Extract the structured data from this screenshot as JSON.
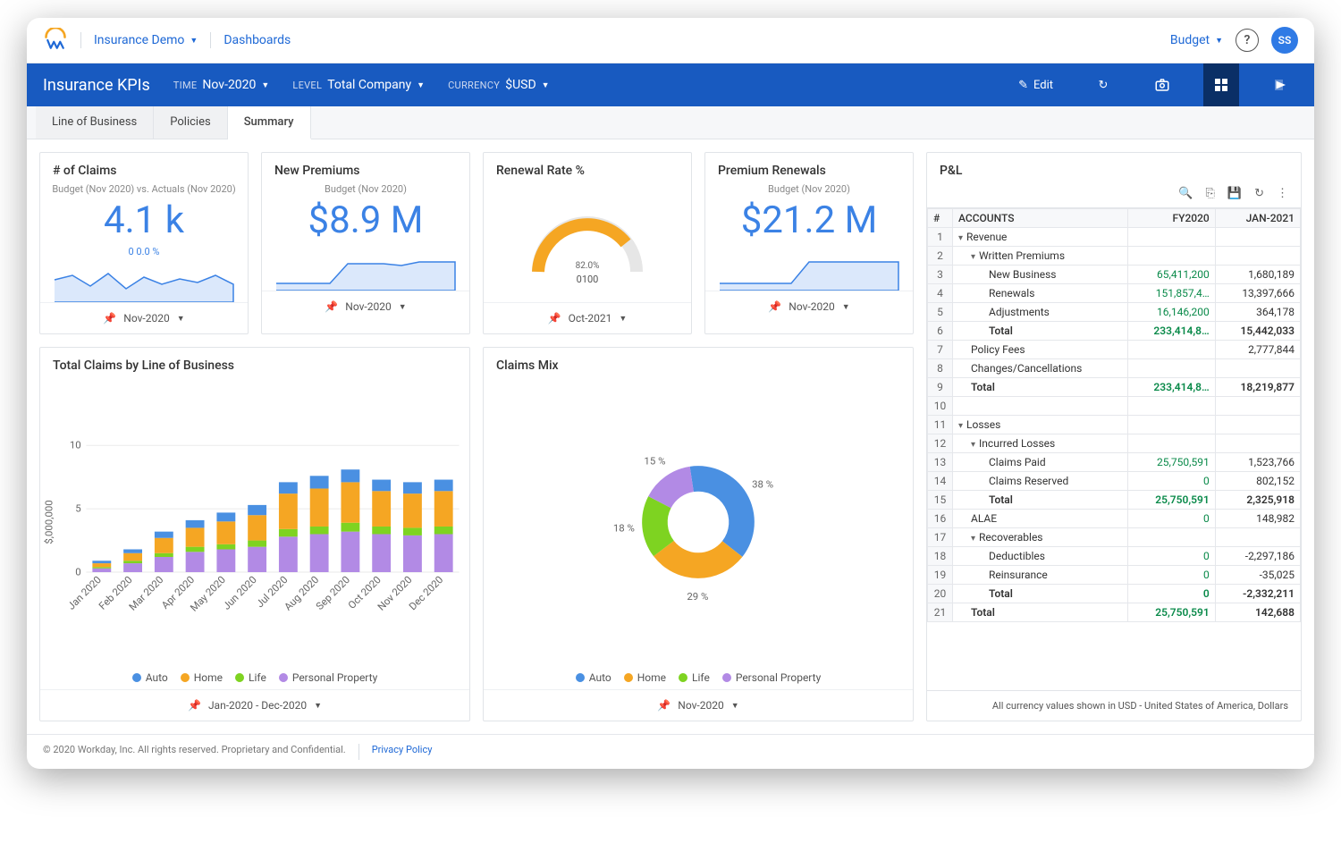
{
  "header": {
    "project": "Insurance Demo",
    "nav2": "Dashboards",
    "right_menu": "Budget",
    "avatar": "SS"
  },
  "bluebar": {
    "title": "Insurance KPIs",
    "time_lbl": "TIME",
    "time_val": "Nov-2020",
    "level_lbl": "LEVEL",
    "level_val": "Total Company",
    "currency_lbl": "CURRENCY",
    "currency_val": "$USD",
    "edit": "Edit"
  },
  "tabs": [
    "Line of Business",
    "Policies",
    "Summary"
  ],
  "active_tab": 2,
  "cards": {
    "claims": {
      "title": "# of Claims",
      "sub": "Budget (Nov 2020) vs. Actuals (Nov 2020)",
      "metric": "4.1 k",
      "delta": "0   0.0 %",
      "foot": "Nov-2020"
    },
    "premiums": {
      "title": "New Premiums",
      "sub": "Budget (Nov 2020)",
      "metric": "$8.9 M",
      "foot": "Nov-2020"
    },
    "renewal": {
      "title": "Renewal Rate %",
      "gauge_pct": "82.0%",
      "g0": "0",
      "g100": "100",
      "foot": "Oct-2021"
    },
    "prenew": {
      "title": "Premium Renewals",
      "sub": "Budget (Nov 2020)",
      "metric": "$21.2 M",
      "foot": "Nov-2020"
    }
  },
  "totalClaims": {
    "title": "Total Claims by Line of Business",
    "ylabel": "$,000,000",
    "foot": "Jan-2020 - Dec-2020"
  },
  "claimsMix": {
    "title": "Claims Mix",
    "foot": "Nov-2020"
  },
  "legend": {
    "auto": "Auto",
    "home": "Home",
    "life": "Life",
    "pp": "Personal Property"
  },
  "colors": {
    "auto": "#4a90e2",
    "home": "#f5a623",
    "life": "#7ed321",
    "pp": "#b28ae5"
  },
  "pnl": {
    "title": "P&L",
    "headers": {
      "acct": "ACCOUNTS",
      "c1": "FY2020",
      "c2": "JAN-2021"
    },
    "rows": [
      {
        "n": 1,
        "lvl": 0,
        "caret": "▾",
        "label": "Revenue",
        "c1": "",
        "c2": ""
      },
      {
        "n": 2,
        "lvl": 1,
        "caret": "▾",
        "label": "Written Premiums",
        "c1": "",
        "c2": ""
      },
      {
        "n": 3,
        "lvl": 2,
        "label": "New Business",
        "c1": "65,411,200",
        "c2": "1,680,189",
        "g1": true
      },
      {
        "n": 4,
        "lvl": 2,
        "label": "Renewals",
        "c1": "151,857,4…",
        "c2": "13,397,666",
        "g1": true
      },
      {
        "n": 5,
        "lvl": 2,
        "label": "Adjustments",
        "c1": "16,146,200",
        "c2": "364,178",
        "g1": true
      },
      {
        "n": 6,
        "lvl": 2,
        "label": "Total",
        "c1": "233,414,8…",
        "c2": "15,442,033",
        "g1": true,
        "bold": true
      },
      {
        "n": 7,
        "lvl": 1,
        "label": "Policy Fees",
        "c1": "",
        "c2": "2,777,844"
      },
      {
        "n": 8,
        "lvl": 1,
        "label": "Changes/Cancellations",
        "c1": "",
        "c2": ""
      },
      {
        "n": 9,
        "lvl": 1,
        "label": "Total",
        "c1": "233,414,8…",
        "c2": "18,219,877",
        "g1": true,
        "bold": true
      },
      {
        "n": 10,
        "lvl": 0,
        "label": "",
        "c1": "",
        "c2": ""
      },
      {
        "n": 11,
        "lvl": 0,
        "caret": "▾",
        "label": "Losses",
        "c1": "",
        "c2": ""
      },
      {
        "n": 12,
        "lvl": 1,
        "caret": "▾",
        "label": "Incurred Losses",
        "c1": "",
        "c2": ""
      },
      {
        "n": 13,
        "lvl": 2,
        "label": "Claims Paid",
        "c1": "25,750,591",
        "c2": "1,523,766",
        "g1": true
      },
      {
        "n": 14,
        "lvl": 2,
        "label": "Claims Reserved",
        "c1": "0",
        "c2": "802,152",
        "g1": true
      },
      {
        "n": 15,
        "lvl": 2,
        "label": "Total",
        "c1": "25,750,591",
        "c2": "2,325,918",
        "g1": true,
        "bold": true
      },
      {
        "n": 16,
        "lvl": 1,
        "label": "ALAE",
        "c1": "0",
        "c2": "148,982",
        "g1": true
      },
      {
        "n": 17,
        "lvl": 1,
        "caret": "▾",
        "label": "Recoverables",
        "c1": "",
        "c2": ""
      },
      {
        "n": 18,
        "lvl": 2,
        "label": "Deductibles",
        "c1": "0",
        "c2": "-2,297,186",
        "g1": true
      },
      {
        "n": 19,
        "lvl": 2,
        "label": "Reinsurance",
        "c1": "0",
        "c2": "-35,025",
        "g1": true
      },
      {
        "n": 20,
        "lvl": 2,
        "label": "Total",
        "c1": "0",
        "c2": "-2,332,211",
        "g1": true,
        "bold": true
      },
      {
        "n": 21,
        "lvl": 1,
        "label": "Total",
        "c1": "25,750,591",
        "c2": "142,688",
        "g1": true,
        "bold": true
      }
    ],
    "footer": "All currency values shown in USD - United States of America, Dollars"
  },
  "footer": {
    "copy": "© 2020 Workday, Inc. All rights reserved. Proprietary and Confidential.",
    "privacy": "Privacy Policy"
  },
  "chart_data": [
    {
      "type": "bar",
      "title": "Total Claims by Line of Business",
      "stacked": true,
      "ylabel": "$,000,000",
      "ylim": [
        0,
        10
      ],
      "categories": [
        "Jan 2020",
        "Feb 2020",
        "Mar 2020",
        "Apr 2020",
        "May 2020",
        "Jun 2020",
        "Jul 2020",
        "Aug 2020",
        "Sep 2020",
        "Oct 2020",
        "Nov 2020",
        "Dec 2020"
      ],
      "series": [
        {
          "name": "Auto",
          "color": "#4a90e2",
          "values": [
            0.2,
            0.3,
            0.5,
            0.6,
            0.7,
            0.8,
            0.9,
            1.0,
            1.0,
            0.9,
            0.9,
            0.9
          ]
        },
        {
          "name": "Home",
          "color": "#f5a623",
          "values": [
            0.3,
            0.6,
            1.2,
            1.5,
            1.8,
            2.0,
            2.8,
            3.0,
            3.2,
            2.8,
            2.7,
            2.8
          ]
        },
        {
          "name": "Life",
          "color": "#7ed321",
          "values": [
            0.1,
            0.2,
            0.3,
            0.4,
            0.4,
            0.5,
            0.6,
            0.6,
            0.7,
            0.6,
            0.6,
            0.6
          ]
        },
        {
          "name": "Personal Property",
          "color": "#b28ae5",
          "values": [
            0.3,
            0.7,
            1.2,
            1.6,
            1.8,
            2.0,
            2.8,
            3.0,
            3.2,
            3.0,
            2.9,
            3.0
          ]
        }
      ]
    },
    {
      "type": "pie",
      "title": "Claims Mix",
      "donut": true,
      "series": [
        {
          "name": "Auto",
          "color": "#4a90e2",
          "value": 38,
          "label": "38 %"
        },
        {
          "name": "Home",
          "color": "#f5a623",
          "value": 29,
          "label": "29 %"
        },
        {
          "name": "Life",
          "color": "#7ed321",
          "value": 18,
          "label": "18 %"
        },
        {
          "name": "Personal Property",
          "color": "#b28ae5",
          "value": 15,
          "label": "15 %"
        }
      ]
    },
    {
      "type": "gauge",
      "title": "Renewal Rate %",
      "value": 82,
      "range": [
        0,
        100
      ],
      "label": "82.0%"
    }
  ]
}
